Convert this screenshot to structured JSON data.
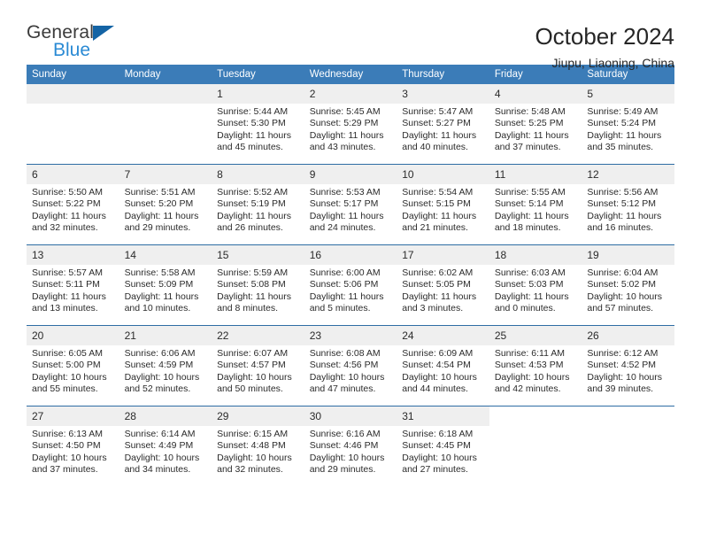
{
  "brand": {
    "name_top": "General",
    "name_bottom": "Blue",
    "triangle_color": "#1464a5",
    "blue_color": "#2a8ad4"
  },
  "header": {
    "title": "October 2024",
    "subtitle": "Jiupu, Liaoning, China"
  },
  "theme": {
    "header_bg": "#3b7cb8",
    "row_divider": "#2e6da4",
    "daynum_bg": "#efefef"
  },
  "weekdays": [
    "Sunday",
    "Monday",
    "Tuesday",
    "Wednesday",
    "Thursday",
    "Friday",
    "Saturday"
  ],
  "labels": {
    "sunrise_prefix": "Sunrise: ",
    "sunset_prefix": "Sunset: ",
    "daylight_prefix": "Daylight: "
  },
  "weeks": [
    [
      {
        "day": "",
        "sunrise": "",
        "sunset": "",
        "daylight": "",
        "empty": true,
        "blank": false
      },
      {
        "day": "",
        "sunrise": "",
        "sunset": "",
        "daylight": "",
        "empty": true,
        "blank": false
      },
      {
        "day": "1",
        "sunrise": "Sunrise: 5:44 AM",
        "sunset": "Sunset: 5:30 PM",
        "daylight": "Daylight: 11 hours and 45 minutes."
      },
      {
        "day": "2",
        "sunrise": "Sunrise: 5:45 AM",
        "sunset": "Sunset: 5:29 PM",
        "daylight": "Daylight: 11 hours and 43 minutes."
      },
      {
        "day": "3",
        "sunrise": "Sunrise: 5:47 AM",
        "sunset": "Sunset: 5:27 PM",
        "daylight": "Daylight: 11 hours and 40 minutes."
      },
      {
        "day": "4",
        "sunrise": "Sunrise: 5:48 AM",
        "sunset": "Sunset: 5:25 PM",
        "daylight": "Daylight: 11 hours and 37 minutes."
      },
      {
        "day": "5",
        "sunrise": "Sunrise: 5:49 AM",
        "sunset": "Sunset: 5:24 PM",
        "daylight": "Daylight: 11 hours and 35 minutes."
      }
    ],
    [
      {
        "day": "6",
        "sunrise": "Sunrise: 5:50 AM",
        "sunset": "Sunset: 5:22 PM",
        "daylight": "Daylight: 11 hours and 32 minutes."
      },
      {
        "day": "7",
        "sunrise": "Sunrise: 5:51 AM",
        "sunset": "Sunset: 5:20 PM",
        "daylight": "Daylight: 11 hours and 29 minutes."
      },
      {
        "day": "8",
        "sunrise": "Sunrise: 5:52 AM",
        "sunset": "Sunset: 5:19 PM",
        "daylight": "Daylight: 11 hours and 26 minutes."
      },
      {
        "day": "9",
        "sunrise": "Sunrise: 5:53 AM",
        "sunset": "Sunset: 5:17 PM",
        "daylight": "Daylight: 11 hours and 24 minutes."
      },
      {
        "day": "10",
        "sunrise": "Sunrise: 5:54 AM",
        "sunset": "Sunset: 5:15 PM",
        "daylight": "Daylight: 11 hours and 21 minutes."
      },
      {
        "day": "11",
        "sunrise": "Sunrise: 5:55 AM",
        "sunset": "Sunset: 5:14 PM",
        "daylight": "Daylight: 11 hours and 18 minutes."
      },
      {
        "day": "12",
        "sunrise": "Sunrise: 5:56 AM",
        "sunset": "Sunset: 5:12 PM",
        "daylight": "Daylight: 11 hours and 16 minutes."
      }
    ],
    [
      {
        "day": "13",
        "sunrise": "Sunrise: 5:57 AM",
        "sunset": "Sunset: 5:11 PM",
        "daylight": "Daylight: 11 hours and 13 minutes."
      },
      {
        "day": "14",
        "sunrise": "Sunrise: 5:58 AM",
        "sunset": "Sunset: 5:09 PM",
        "daylight": "Daylight: 11 hours and 10 minutes."
      },
      {
        "day": "15",
        "sunrise": "Sunrise: 5:59 AM",
        "sunset": "Sunset: 5:08 PM",
        "daylight": "Daylight: 11 hours and 8 minutes."
      },
      {
        "day": "16",
        "sunrise": "Sunrise: 6:00 AM",
        "sunset": "Sunset: 5:06 PM",
        "daylight": "Daylight: 11 hours and 5 minutes."
      },
      {
        "day": "17",
        "sunrise": "Sunrise: 6:02 AM",
        "sunset": "Sunset: 5:05 PM",
        "daylight": "Daylight: 11 hours and 3 minutes."
      },
      {
        "day": "18",
        "sunrise": "Sunrise: 6:03 AM",
        "sunset": "Sunset: 5:03 PM",
        "daylight": "Daylight: 11 hours and 0 minutes."
      },
      {
        "day": "19",
        "sunrise": "Sunrise: 6:04 AM",
        "sunset": "Sunset: 5:02 PM",
        "daylight": "Daylight: 10 hours and 57 minutes."
      }
    ],
    [
      {
        "day": "20",
        "sunrise": "Sunrise: 6:05 AM",
        "sunset": "Sunset: 5:00 PM",
        "daylight": "Daylight: 10 hours and 55 minutes."
      },
      {
        "day": "21",
        "sunrise": "Sunrise: 6:06 AM",
        "sunset": "Sunset: 4:59 PM",
        "daylight": "Daylight: 10 hours and 52 minutes."
      },
      {
        "day": "22",
        "sunrise": "Sunrise: 6:07 AM",
        "sunset": "Sunset: 4:57 PM",
        "daylight": "Daylight: 10 hours and 50 minutes."
      },
      {
        "day": "23",
        "sunrise": "Sunrise: 6:08 AM",
        "sunset": "Sunset: 4:56 PM",
        "daylight": "Daylight: 10 hours and 47 minutes."
      },
      {
        "day": "24",
        "sunrise": "Sunrise: 6:09 AM",
        "sunset": "Sunset: 4:54 PM",
        "daylight": "Daylight: 10 hours and 44 minutes."
      },
      {
        "day": "25",
        "sunrise": "Sunrise: 6:11 AM",
        "sunset": "Sunset: 4:53 PM",
        "daylight": "Daylight: 10 hours and 42 minutes."
      },
      {
        "day": "26",
        "sunrise": "Sunrise: 6:12 AM",
        "sunset": "Sunset: 4:52 PM",
        "daylight": "Daylight: 10 hours and 39 minutes."
      }
    ],
    [
      {
        "day": "27",
        "sunrise": "Sunrise: 6:13 AM",
        "sunset": "Sunset: 4:50 PM",
        "daylight": "Daylight: 10 hours and 37 minutes."
      },
      {
        "day": "28",
        "sunrise": "Sunrise: 6:14 AM",
        "sunset": "Sunset: 4:49 PM",
        "daylight": "Daylight: 10 hours and 34 minutes."
      },
      {
        "day": "29",
        "sunrise": "Sunrise: 6:15 AM",
        "sunset": "Sunset: 4:48 PM",
        "daylight": "Daylight: 10 hours and 32 minutes."
      },
      {
        "day": "30",
        "sunrise": "Sunrise: 6:16 AM",
        "sunset": "Sunset: 4:46 PM",
        "daylight": "Daylight: 10 hours and 29 minutes."
      },
      {
        "day": "31",
        "sunrise": "Sunrise: 6:18 AM",
        "sunset": "Sunset: 4:45 PM",
        "daylight": "Daylight: 10 hours and 27 minutes."
      },
      {
        "day": "",
        "sunrise": "",
        "sunset": "",
        "daylight": "",
        "empty": true,
        "blank": true
      },
      {
        "day": "",
        "sunrise": "",
        "sunset": "",
        "daylight": "",
        "empty": true,
        "blank": true
      }
    ]
  ]
}
